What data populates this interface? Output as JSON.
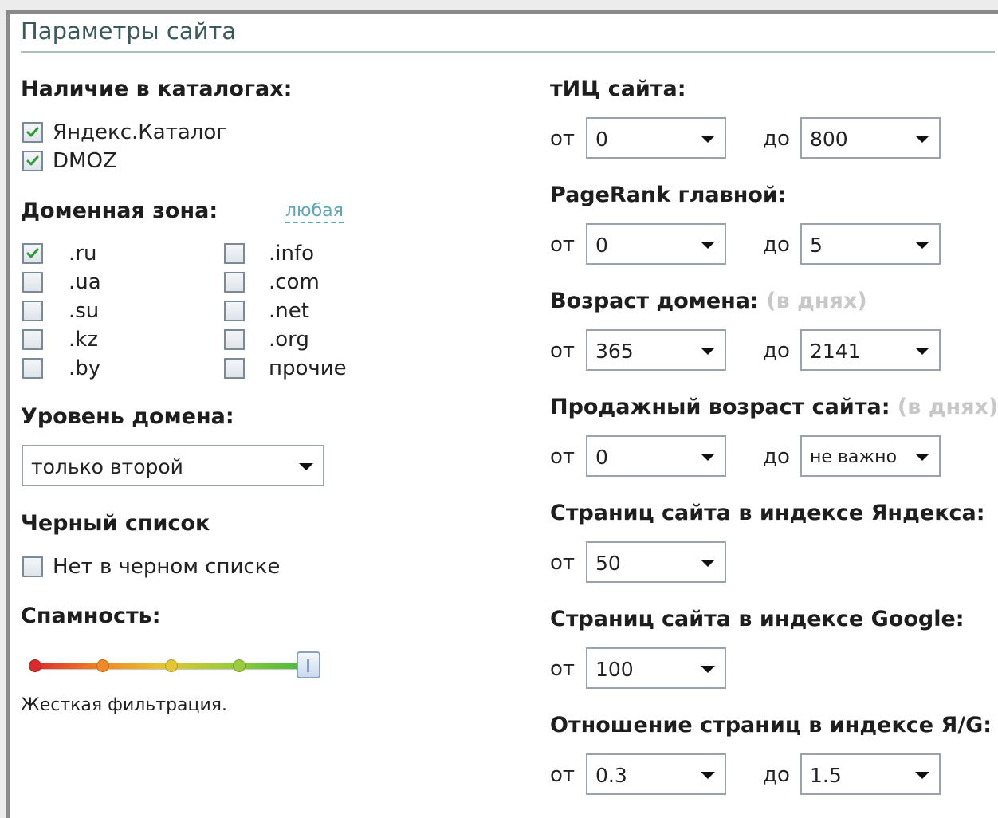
{
  "panel": {
    "title": "Параметры сайта"
  },
  "left": {
    "catalogs": {
      "heading": "Наличие в каталогах:",
      "items": [
        {
          "label": "Яндекс.Каталог",
          "checked": true
        },
        {
          "label": "DMOZ",
          "checked": true
        }
      ]
    },
    "domain_zone": {
      "heading": "Доменная зона:",
      "any_link": "любая",
      "col1": [
        {
          "label": ".ru",
          "checked": true
        },
        {
          "label": ".ua",
          "checked": false
        },
        {
          "label": ".su",
          "checked": false
        },
        {
          "label": ".kz",
          "checked": false
        },
        {
          "label": ".by",
          "checked": false
        }
      ],
      "col2": [
        {
          "label": ".info",
          "checked": false
        },
        {
          "label": ".com",
          "checked": false
        },
        {
          "label": ".net",
          "checked": false
        },
        {
          "label": ".org",
          "checked": false
        },
        {
          "label": "прочие",
          "checked": false
        }
      ]
    },
    "domain_level": {
      "heading": "Уровень домена:",
      "value": "только второй"
    },
    "blacklist": {
      "heading": "Черный список",
      "label": "Нет в черном списке",
      "checked": false
    },
    "spam": {
      "heading": "Спамность:",
      "level": 4,
      "levels": 5,
      "caption": "Жесткая фильтрация.",
      "colors": [
        "#d92b2b",
        "#ef8a26",
        "#e2c636",
        "#9bcc3c",
        "#4ab83c"
      ]
    }
  },
  "right": {
    "from_label": "от",
    "to_label": "до",
    "tic": {
      "heading": "тИЦ сайта:",
      "from": "0",
      "to": "800"
    },
    "pagerank": {
      "heading": "PageRank главной:",
      "from": "0",
      "to": "5"
    },
    "domain_age": {
      "heading": "Возраст домена:",
      "hint": "(в днях)",
      "from": "365",
      "to": "2141"
    },
    "sale_age": {
      "heading": "Продажный возраст сайта:",
      "hint": "(в днях)",
      "from": "0",
      "to": "не важно"
    },
    "yandex_pages": {
      "heading": "Страниц сайта в индексе Яндекса:",
      "from": "50"
    },
    "google_pages": {
      "heading": "Страниц сайта в индексе Google:",
      "from": "100"
    },
    "ratio": {
      "heading": "Отношение страниц в индексе Я/G:",
      "from": "0.3",
      "to": "1.5"
    }
  },
  "colors": {
    "check": "#2e9a35",
    "title": "#3a5a5c",
    "link": "#5ea7b4",
    "hint": "#c8c8c8"
  }
}
